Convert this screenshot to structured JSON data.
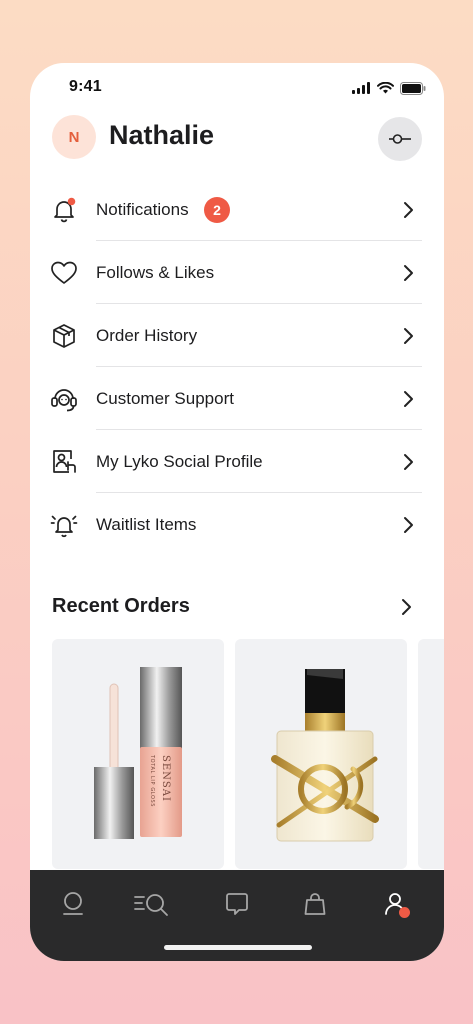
{
  "status_bar": {
    "time": "9:41"
  },
  "header": {
    "avatar_initial": "N",
    "user_name": "Nathalie",
    "settings_icon": "key-icon"
  },
  "menu": {
    "items": [
      {
        "label": "Notifications",
        "icon": "bell-icon",
        "badge": "2"
      },
      {
        "label": "Follows & Likes",
        "icon": "heart-icon"
      },
      {
        "label": "Order History",
        "icon": "box-icon"
      },
      {
        "label": "Customer Support",
        "icon": "headset-icon"
      },
      {
        "label": "My Lyko Social Profile",
        "icon": "profile-card-icon"
      },
      {
        "label": "Waitlist Items",
        "icon": "alarm-bell-icon"
      }
    ]
  },
  "recent_orders": {
    "title": "Recent Orders",
    "items": [
      {
        "product": "lip-gloss-image",
        "brand_text": "SENSAI",
        "sub_text": "TOTAL LIP GLOSS"
      },
      {
        "product": "perfume-bottle-image",
        "brand_text": "YSL"
      }
    ]
  },
  "tab_bar": {
    "tabs": [
      {
        "icon": "home-icon"
      },
      {
        "icon": "search-list-icon"
      },
      {
        "icon": "chat-icon"
      },
      {
        "icon": "bag-icon"
      },
      {
        "icon": "profile-icon",
        "active": true
      }
    ]
  },
  "colors": {
    "accent": "#ef5a45",
    "tab_bar_bg": "#2a2a2b",
    "avatar_bg": "#fde3d8",
    "card_bg": "#f1f2f4"
  }
}
